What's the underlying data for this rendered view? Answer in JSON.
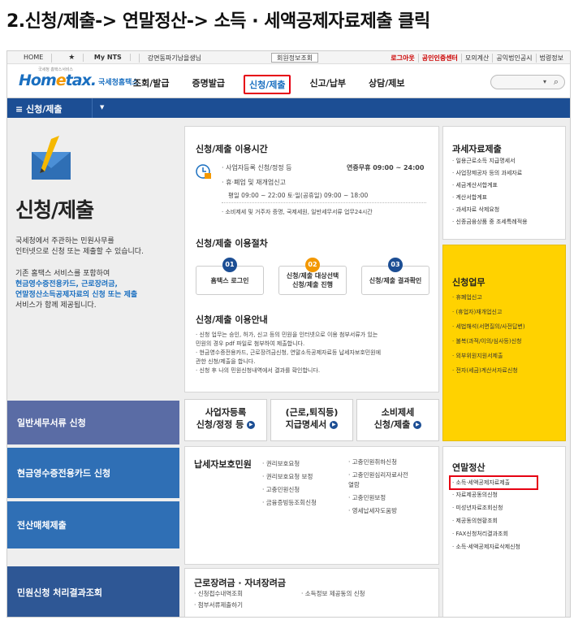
{
  "caption": "2.신청/제출-> 연말정산-> 소득 · 세액공제자료제출 클릭",
  "util": {
    "home": "HOME",
    "my_nts": "My NTS",
    "location": "강면동파기남을생님",
    "member_lookup": "회원정보조회",
    "right_links": [
      "로그아웃",
      "공인인증센터",
      "모의계산",
      "공익법인공시",
      "법령정보"
    ]
  },
  "logo": {
    "sub": "국세청 홈택스서비스",
    "brand_a": "Hom",
    "brand_b": "e",
    "brand_c": "tax.",
    "kr": "국세청홈택스"
  },
  "menu": [
    "조회/발급",
    "증명발급",
    "신청/제출",
    "신고/납부",
    "상담/제보"
  ],
  "menu_selected": "신청/제출",
  "breadcrumb": "≡ 신청/제출",
  "hero": {
    "title": "신청/제출",
    "desc": [
      "국세청에서 주관하는 민원사무를",
      "인터넷으로 신청 또는 제출할 수 있습니다."
    ],
    "desc2_intro": "기존 홈택스 서비스를 포함하여",
    "desc2_blue": [
      "현금영수증전용카드, 근로장려금,",
      "연말정산소득공제자료의 신청 또는 제출"
    ],
    "desc2_end": "서비스가 함께 제공됩니다."
  },
  "left_buttons": [
    "일반세무서류 신청",
    "현금영수증전용카드 신청",
    "전산매체제출",
    "민원신청 처리결과조회"
  ],
  "hours": {
    "title": "신청/제출 이용시간",
    "row1_label": "· 사업자등록 신청/정정 등",
    "row1_value": "연중무휴 09:00 ~ 24:00",
    "row2_label": "· 휴·폐업 및 재개업신고",
    "row2_value": "평일 09:00 ~ 22:00 토·일(공휴일) 09:00 ~ 18:00",
    "row3": "· 소비제세 및 거주자 증명, 국제세원, 일반세무서류 업무24시간"
  },
  "steps": {
    "title": "신청/제출 이용절차",
    "items": [
      {
        "num": "01",
        "label": "홈택스 로그인"
      },
      {
        "num": "02",
        "label": "신청/제출 대상선택 신청/제출 진행"
      },
      {
        "num": "03",
        "label": "신청/제출 결과확인"
      }
    ]
  },
  "guide": {
    "title": "신청/제출 이용안내",
    "lines": [
      "· 신청 업무는 승인, 허가, 신고 등의 민원을 인터넷으로 이용 첨부서류가 있는",
      "  민원의 경우 pdf 파일로 첨부하여 제출합니다.",
      "· 현금영수증전용카드, 근로장려금신청, 연말소득공제자료등 납세자보호민원에",
      "  관한 신청/제출을 합니다.",
      "· 신청 후 나의 민원신청내역에서 결과를 확인합니다."
    ]
  },
  "mid_buttons": [
    {
      "l1": "사업자등록",
      "l2": "신청/정정 등"
    },
    {
      "l1": "(근로,퇴직등)",
      "l2": "지급명세서"
    },
    {
      "l1": "소비제세",
      "l2": "신청/제출"
    }
  ],
  "protect": {
    "title": "납세자보호민원",
    "col1": [
      "· 권리보호요청",
      "· 권리보호요청 보정",
      "· 고충민원신청",
      "· 금융증빙등조회신청"
    ],
    "col2": [
      "· 고충민원취하신청",
      "· 고충민원심리자료사전",
      "  열람",
      "· 고충민원보정",
      "· 영세납세자도움방"
    ]
  },
  "incentive": {
    "title": "근로장려금 · 자녀장려금",
    "items": [
      "· 신청접수내역조회",
      "· 소득정보 제공동의 신청",
      "· 첨부서류제출하기"
    ]
  },
  "tax_material": {
    "title": "과세자료제출",
    "items": [
      "· 일용근로소득 지급명세서",
      "· 사업장제공자 등의 과세자료",
      "· 세금계산서합계표",
      "· 계산서합계표",
      "· 과세자료 삭제요청",
      "· 신종금융상품 중 조세특례적용"
    ]
  },
  "apply_work": {
    "title": "신청업무",
    "items": [
      "· 휴폐업신고",
      "· (휴업자)재개업신고",
      "· 세법해석(서면질의/사전답변)",
      "· 불복(과적/이의/심사등)신청",
      "· 외부위원지원서제출",
      "· 전자(세금)계산서자료신청"
    ]
  },
  "year_end": {
    "title": "연말정산",
    "highlight": "· 소득·세액공제자료제출",
    "items": [
      "· 자료제공동의신청",
      "· 미성년자료조회신청",
      "· 제공동의현황조회",
      "· FAX신청처리결과조회",
      "· 소득·세액공제자료삭제신청"
    ]
  }
}
